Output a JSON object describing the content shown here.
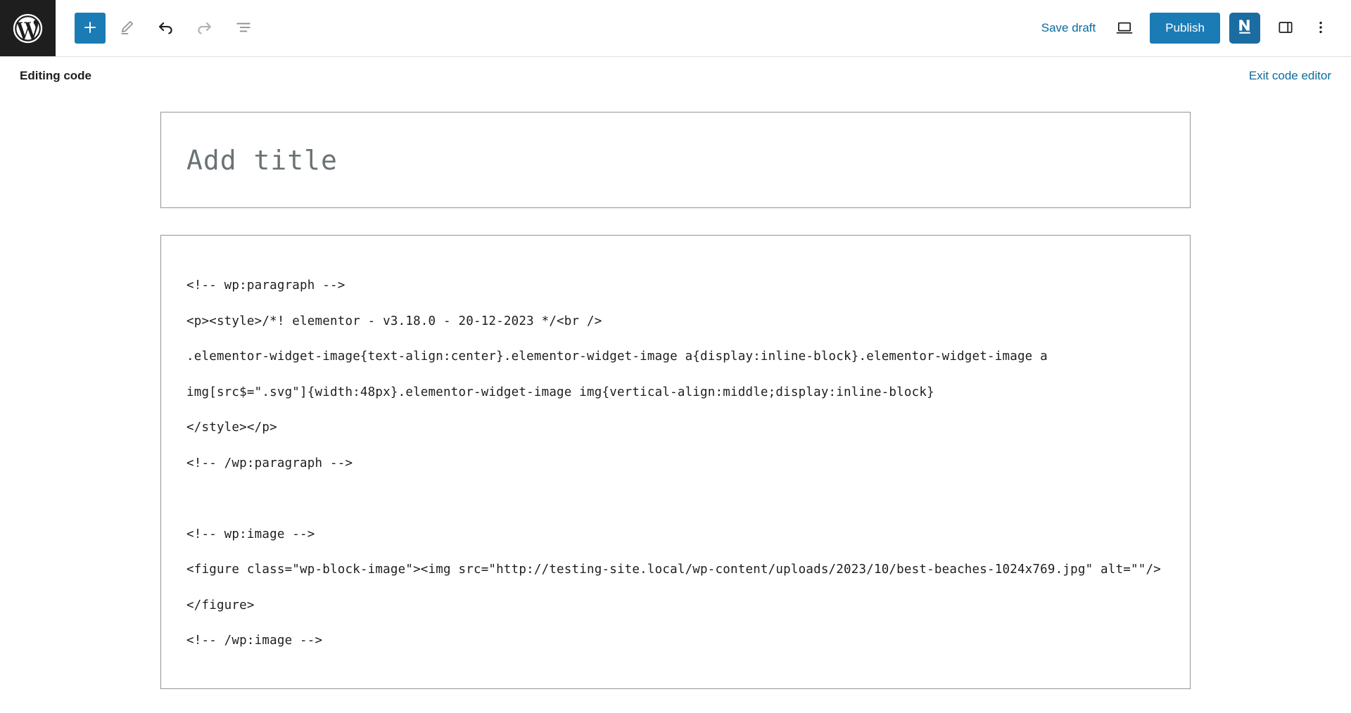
{
  "toolbar": {
    "wp_logo": "wordpress-logo",
    "add_block_label": "+",
    "tools_icon": "pencil-icon",
    "undo_icon": "undo-arrow-icon",
    "redo_icon": "redo-arrow-icon",
    "list_view_icon": "list-view-icon",
    "save_draft_label": "Save draft",
    "preview_icon": "laptop-preview-icon",
    "publish_label": "Publish",
    "plugin_badge_letter": "N",
    "settings_sidebar_icon": "sidebar-panel-icon",
    "options_icon": "vertical-ellipsis-icon"
  },
  "editor_bar": {
    "mode_label": "Editing code",
    "exit_label": "Exit code editor"
  },
  "post": {
    "title_placeholder": "Add title",
    "title_value": "",
    "code_content": "<!-- wp:paragraph -->\n<p><style>/*! elementor - v3.18.0 - 20-12-2023 */<br />\n.elementor-widget-image{text-align:center}.elementor-widget-image a{display:inline-block}.elementor-widget-image a img[src$=\".svg\"]{width:48px}.elementor-widget-image img{vertical-align:middle;display:inline-block}\n</style></p>\n<!-- /wp:paragraph -->\n\n<!-- wp:image -->\n<figure class=\"wp-block-image\"><img src=\"http://testing-site.local/wp-content/uploads/2023/10/best-beaches-1024x769.jpg\" alt=\"\"/></figure>\n<!-- /wp:image -->"
  },
  "colors": {
    "accent_blue": "#1b7cb5",
    "link_blue": "#0b6a9e",
    "logo_bg": "#1e1e1e",
    "border_gray": "#949494"
  }
}
